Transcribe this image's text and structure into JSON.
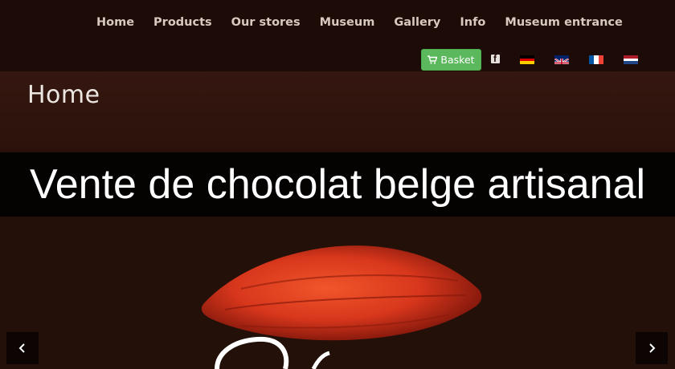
{
  "nav": {
    "items": [
      {
        "label": "Home"
      },
      {
        "label": "Products"
      },
      {
        "label": "Our stores"
      },
      {
        "label": "Museum"
      },
      {
        "label": "Gallery"
      },
      {
        "label": "Info"
      },
      {
        "label": "Museum entrance"
      }
    ],
    "basket_label": "Basket",
    "basket_icon": "shopping-cart-icon",
    "social_icon": "facebook-icon",
    "languages": [
      {
        "icon": "german-flag-icon",
        "colors": [
          "#000000",
          "#dd0000",
          "#ffce00"
        ]
      },
      {
        "icon": "uk-flag-icon",
        "colors": [
          "#012169",
          "#ffffff",
          "#c8102e"
        ]
      },
      {
        "icon": "french-flag-icon",
        "colors": [
          "#0055a4",
          "#ffffff",
          "#ef4135"
        ]
      },
      {
        "icon": "dutch-flag-icon",
        "colors": [
          "#ae1c28",
          "#ffffff",
          "#21468b"
        ]
      }
    ]
  },
  "page": {
    "title": "Home"
  },
  "hero": {
    "headline": "Vente de chocolat belge artisanal",
    "image_icon": "cocoa-pod-image",
    "prev_icon": "chevron-left-icon",
    "next_icon": "chevron-right-icon"
  },
  "colors": {
    "background": "#1f0e08",
    "basket_green": "#5cb85c",
    "cocoa_pod": "#d8371c"
  }
}
